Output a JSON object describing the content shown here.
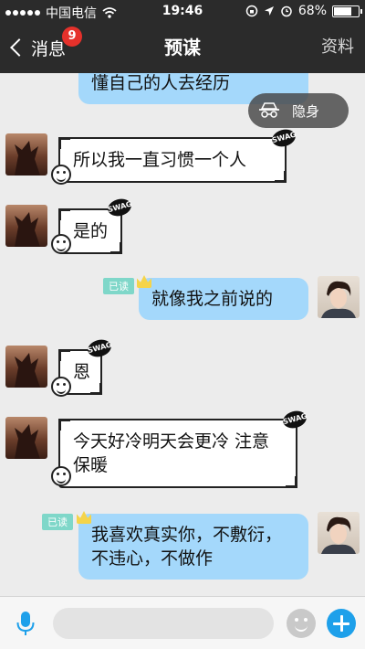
{
  "status_bar": {
    "carrier": "中国电信",
    "time": "19:46",
    "battery": "68%",
    "battery_level": 0.68
  },
  "nav": {
    "back_label": "消息",
    "unread_count": "9",
    "title": "预谋",
    "right_label": "资料"
  },
  "stealth": {
    "label": "隐身"
  },
  "messages": [
    {
      "side": "right",
      "text": "懂自己的人去经历",
      "read": ""
    },
    {
      "side": "left",
      "text": "所以我一直习惯一个人"
    },
    {
      "side": "left",
      "text": "是的"
    },
    {
      "side": "right",
      "text": "就像我之前说的",
      "read": "已读"
    },
    {
      "side": "left",
      "text": "恩"
    },
    {
      "side": "left",
      "text": "今天好冷明天会更冷  注意保暖"
    },
    {
      "side": "right",
      "text": "我喜欢真实你，不敷衍，不违心，不做作",
      "read": "已读"
    }
  ],
  "sticker_tag_text": "SWAG",
  "input": {
    "placeholder": ""
  },
  "icons": {
    "mic": "microphone-icon",
    "emoji": "emoji-icon",
    "plus": "plus-icon",
    "stealth": "incognito-icon",
    "back": "chevron-left-icon"
  },
  "colors": {
    "bar": "#2b2b2b",
    "self_bubble": "#a4d8fb",
    "badge": "#e5312b",
    "accent": "#1ea0ea",
    "read_tag": "#7fd7c9"
  }
}
